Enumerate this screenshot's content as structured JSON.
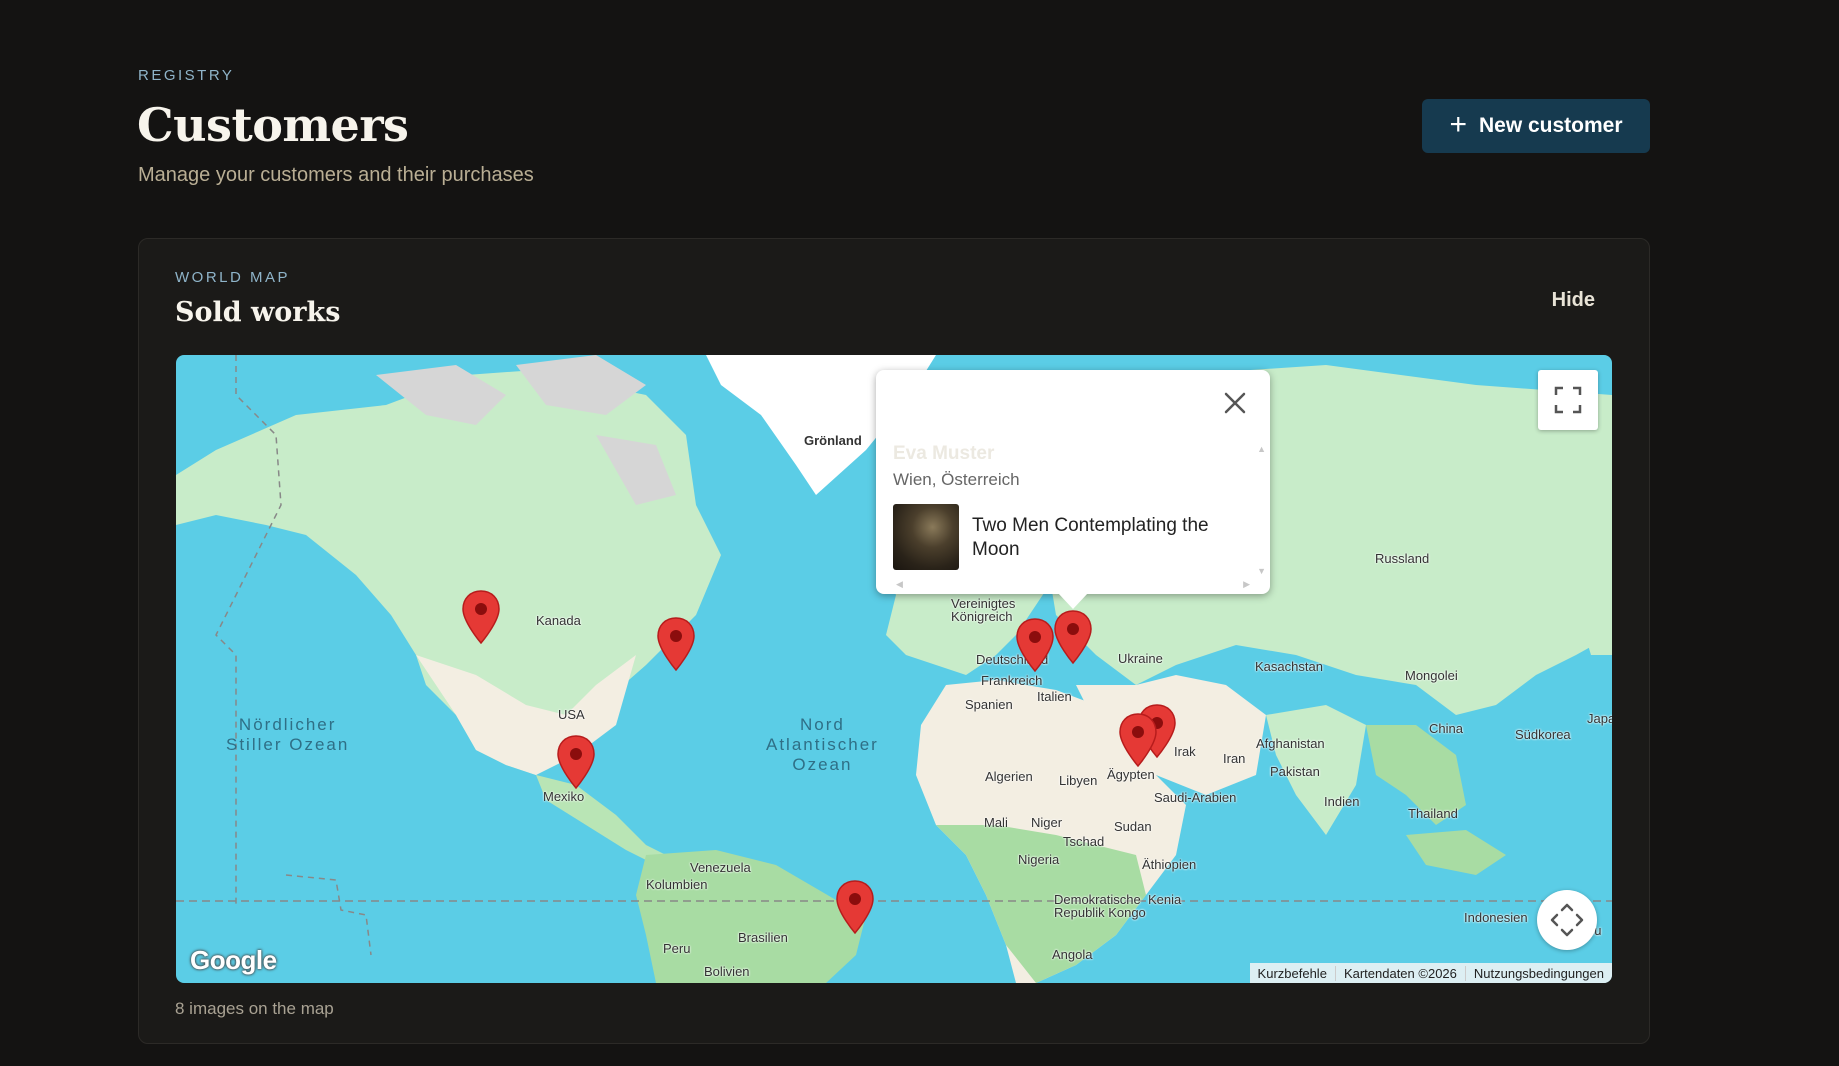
{
  "header": {
    "eyebrow": "REGISTRY",
    "title": "Customers",
    "subtitle": "Manage your customers and their purchases",
    "new_button_label": "New customer"
  },
  "map_panel": {
    "eyebrow": "WORLD MAP",
    "title": "Sold works",
    "hide_label": "Hide",
    "footer": "8 images on the map",
    "labels": {
      "groenland": "Grönland",
      "kanada": "Kanada",
      "usa": "USA",
      "mexiko": "Mexiko",
      "venezuela": "Venezuela",
      "kolumbien": "Kolumbien",
      "peru": "Peru",
      "brasilien": "Brasilien",
      "bolivien": "Bolivien",
      "uk": "Vereinigtes\nKönigreich",
      "deutschland": "Deutschland",
      "frankreich": "Frankreich",
      "spanien": "Spanien",
      "italien": "Italien",
      "ukraine": "Ukraine",
      "russland": "Russland",
      "kasachstan": "Kasachstan",
      "mongolei": "Mongolei",
      "china": "China",
      "suedkorea": "Südkorea",
      "japan": "Japa",
      "afghanistan": "Afghanistan",
      "pakistan": "Pakistan",
      "iran": "Iran",
      "irak": "Irak",
      "indien": "Indien",
      "thailand": "Thailand",
      "indonesien": "Indonesien",
      "algerien": "Algerien",
      "libyen": "Libyen",
      "aegypten": "Ägypten",
      "saudi": "Saudi-Arabien",
      "mali": "Mali",
      "niger": "Niger",
      "tschad": "Tschad",
      "sudan": "Sudan",
      "nigeria": "Nigeria",
      "aethiopien": "Äthiopien",
      "kongo": "Demokratische\nRepublik Kongo",
      "kenia": "Kenia",
      "angola": "Angola",
      "pu": "pu"
    },
    "oceans": {
      "pacific": "Nördlicher\nStiller Ozean",
      "atlantic": "Nord\nAtlantischer\nOzean"
    },
    "popup": {
      "customer_name": "Eva Muster",
      "location": "Wien, Österreich",
      "work_title": "Two Men Contemplating the Moon"
    },
    "google_logo": "Google",
    "attribution": {
      "shortcuts": "Kurzbefehle",
      "map_data": "Kartendaten ©2026",
      "terms": "Nutzungsbedingungen"
    },
    "marker_color": "#e53935"
  }
}
